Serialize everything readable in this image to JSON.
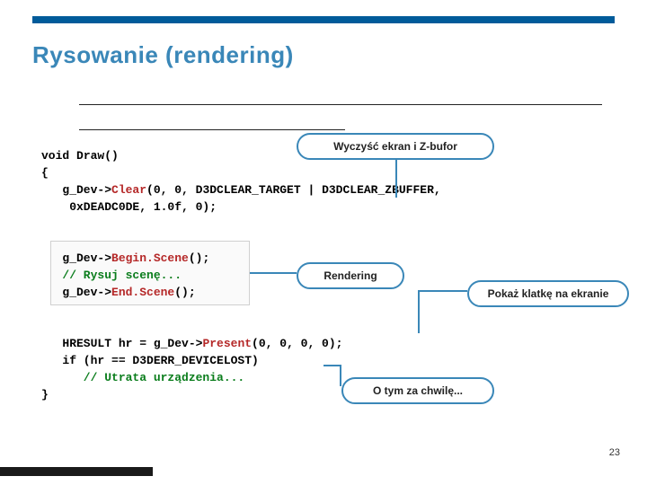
{
  "title": "Rysowanie (rendering)",
  "callouts": {
    "clear": "Wyczyść ekran i Z-bufor",
    "rendering": "Rendering",
    "present": "Pokaż klatkę na ekranie",
    "devicelost": "O tym za chwilę..."
  },
  "code": {
    "sig_void": "void",
    "sig_name": " Draw()",
    "brace_open": "{",
    "clear_obj": "   g_Dev->",
    "clear_fn": "Clear",
    "clear_args": "(0, 0, D3DCLEAR_TARGET | D3DCLEAR_ZBUFFER,",
    "clear_args2": "    0xDEADC0DE, 1.0f, 0);",
    "begin_obj": "   g_Dev->",
    "begin_fn": "Begin.Scene",
    "begin_tail": "();",
    "comment_scene": "   // Rysuj scenę...",
    "end_obj": "   g_Dev->",
    "end_fn": "End.Scene",
    "end_tail": "();",
    "present_lhs": "   HRESULT hr = g_Dev->",
    "present_fn": "Present",
    "present_args": "(0, 0, 0, 0);",
    "if_line": "   if (hr == D3DERR_DEVICELOST)",
    "comment_lost": "      // Utrata urządzenia...",
    "brace_close": "}"
  },
  "page_number": "23"
}
